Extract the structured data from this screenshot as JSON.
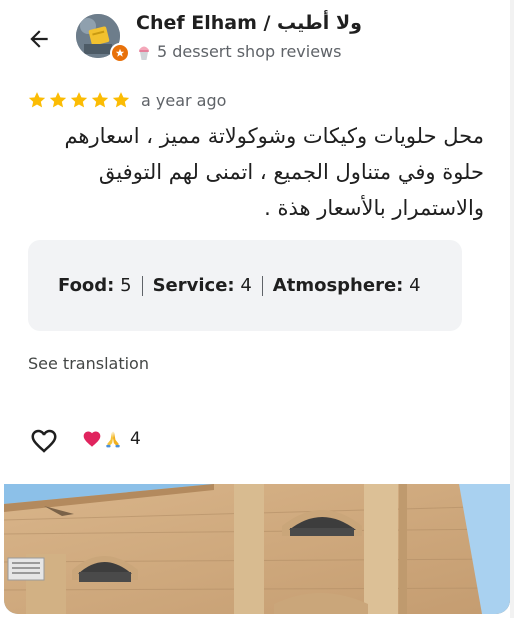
{
  "header": {
    "reviewer_name": "Chef Elham / ولا أطيب",
    "reviewer_meta": "5 dessert shop reviews",
    "back_icon": "arrow-back-icon",
    "meta_icon": "ice-cream-icon"
  },
  "review": {
    "rating": 5,
    "max_rating": 5,
    "time_ago": "a year ago",
    "text": "محل حلويات وكيكات وشوكولاتة مميز ، اسعارهم حلوة وفي متناول الجميع ، اتمنى لهم التوفيق والاستمرار بالأسعار هذة ."
  },
  "ratings_card": {
    "food_label": "Food:",
    "food_value": "5",
    "service_label": "Service:",
    "service_value": "4",
    "atmosphere_label": "Atmosphere:",
    "atmosphere_value": "4"
  },
  "actions": {
    "see_translation": "See translation",
    "like_icon": "heart-outline-icon",
    "reaction_emojis": [
      "heart-emoji",
      "pray-emoji"
    ],
    "reaction_count": "4"
  },
  "colors": {
    "star": "#fbbc04",
    "badge": "#e8710a",
    "card_bg": "#f2f3f5",
    "muted_text": "#5f6368"
  }
}
